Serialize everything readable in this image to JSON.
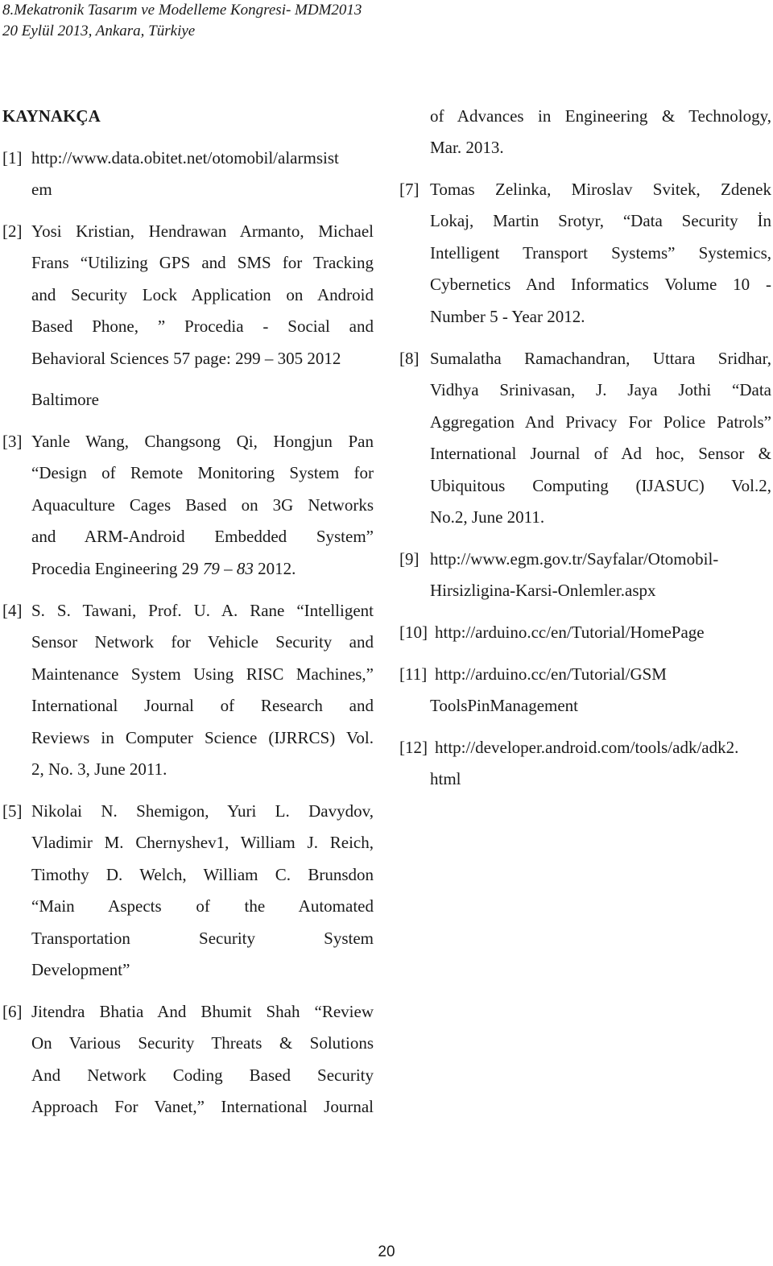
{
  "header": {
    "line1": "8.Mekatronik Tasarım ve Modelleme Kongresi- MDM2013",
    "line2": "20 Eylül 2013, Ankara, Türkiye"
  },
  "section_title": "KAYNAKÇA",
  "references_left": [
    {
      "number": "[1]",
      "lines": [
        "http://www.data.obitet.net/otomobil/alarmsist",
        "em"
      ]
    },
    {
      "number": "[2]",
      "lines": [
        "Yosi Kristian, Hendrawan Armanto, Michael",
        "Frans “Utilizing GPS and SMS for Tracking",
        "and Security Lock Application on Android",
        "Based Phone, ” Procedia - Social and",
        "Behavioral Sciences 57 page: 299 – 305 2012",
        "Baltimore"
      ]
    },
    {
      "number": "[3]",
      "lines": [
        "Yanle Wang, Changsong Qi, Hongjun Pan",
        "“Design of Remote Monitoring System for",
        "Aquaculture Cages Based on 3G Networks",
        "and ARM-Android Embedded System”"
      ],
      "last_line": {
        "before": "Procedia Engineering 29 ",
        "italic": "79 – 83",
        "after": " 2012."
      }
    },
    {
      "number": "[4]",
      "lines": [
        "S. S. Tawani, Prof. U. A. Rane “Intelligent",
        "Sensor Network for Vehicle Security and",
        "Maintenance System Using RISC Machines,”",
        "International Journal of Research and",
        "Reviews in Computer Science (IJRRCS) Vol.",
        "2, No. 3, June 2011."
      ]
    },
    {
      "number": "[5]",
      "lines": [
        "Nikolai N. Shemigon, Yuri L. Davydov,",
        "Vladimir M. Chernyshev1, William J. Reich,",
        "Timothy D. Welch, William C. Brunsdon",
        "“Main Aspects of the Automated",
        "Transportation Security System",
        "Development”"
      ]
    },
    {
      "number": "[6]",
      "lines": [
        "Jitendra Bhatia And Bhumit Shah “Review",
        "On Various Security Threats & Solutions",
        "And Network Coding Based Security",
        "Approach For Vanet,” International Journal"
      ]
    }
  ],
  "references_right": [
    {
      "number": "",
      "lines": [
        "of Advances in Engineering & Technology,",
        "Mar. 2013."
      ]
    },
    {
      "number": "[7]",
      "lines": [
        "Tomas Zelinka, Miroslav Svitek, Zdenek",
        "Lokaj, Martin Srotyr, “Data Security İn",
        "Intelligent Transport Systems” Systemics,",
        "Cybernetics And Informatics Volume 10 -",
        "Number 5 - Year 2012."
      ]
    },
    {
      "number": "[8]",
      "lines": [
        "Sumalatha Ramachandran, Uttara Sridhar,",
        "Vidhya Srinivasan, J. Jaya Jothi “Data",
        "Aggregation And Privacy For Police Patrols”",
        "International Journal of Ad hoc, Sensor &",
        "Ubiquitous Computing (IJASUC) Vol.2,",
        "No.2, June 2011."
      ]
    },
    {
      "number": "[9]",
      "lines": [
        "http://www.egm.gov.tr/Sayfalar/Otomobil-",
        "Hirsizligina-Karsi-Onlemler.aspx"
      ]
    },
    {
      "number": "[10]",
      "lines": [
        "http://arduino.cc/en/Tutorial/HomePage"
      ]
    },
    {
      "number": "[11]",
      "lines": [
        "http://arduino.cc/en/Tutorial/GSM",
        "ToolsPinManagement"
      ]
    },
    {
      "number": "[12]",
      "lines": [
        "http://developer.android.com/tools/adk/adk2.",
        "html"
      ]
    }
  ],
  "page_number": "20"
}
